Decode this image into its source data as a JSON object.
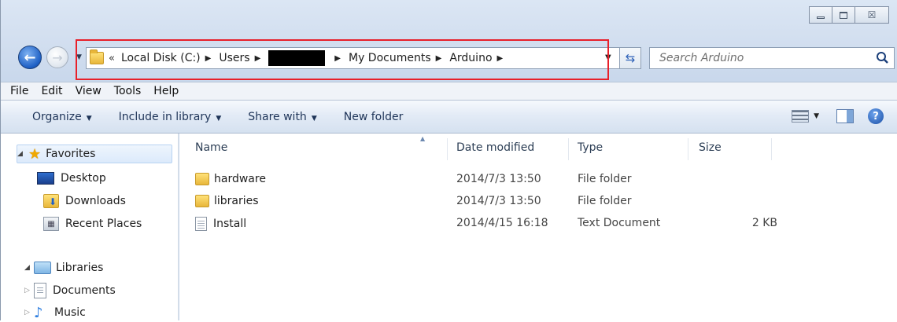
{
  "window": {
    "controls": {
      "minimize_icon": "minimize-icon",
      "maximize_icon": "maximize-icon",
      "close_glyph": "☒"
    }
  },
  "nav": {
    "back_glyph": "←",
    "forward_glyph": "→",
    "breadcrumb": {
      "overflow": "«",
      "items": [
        "Local Disk (C:)",
        "Users",
        "",
        "My Documents",
        "Arduino"
      ],
      "separator": "▶"
    },
    "refresh_glyph": "⇆",
    "search": {
      "placeholder": "Search Arduino"
    }
  },
  "menubar": {
    "items": [
      "File",
      "Edit",
      "View",
      "Tools",
      "Help"
    ]
  },
  "commandbar": {
    "organize": "Organize",
    "include_in_library": "Include in library",
    "share_with": "Share with",
    "new_folder": "New folder",
    "dropdown_glyph": "▼"
  },
  "navpane": {
    "favorites": {
      "label": "Favorites",
      "items": [
        "Desktop",
        "Downloads",
        "Recent Places"
      ]
    },
    "libraries": {
      "label": "Libraries",
      "items": [
        "Documents",
        "Music"
      ]
    }
  },
  "filelist": {
    "columns": {
      "name": "Name",
      "date": "Date modified",
      "type": "Type",
      "size": "Size"
    },
    "rows": [
      {
        "name": "hardware",
        "date": "2014/7/3 13:50",
        "type": "File folder",
        "size": "",
        "icon": "folder-icon"
      },
      {
        "name": "libraries",
        "date": "2014/7/3 13:50",
        "type": "File folder",
        "size": "",
        "icon": "folder-icon"
      },
      {
        "name": "Install",
        "date": "2014/4/15 16:18",
        "type": "Text Document",
        "size": "2 KB",
        "icon": "text-document-icon"
      }
    ]
  },
  "colors": {
    "highlight_border": "#e8202a",
    "accent": "#1d5fc4"
  }
}
